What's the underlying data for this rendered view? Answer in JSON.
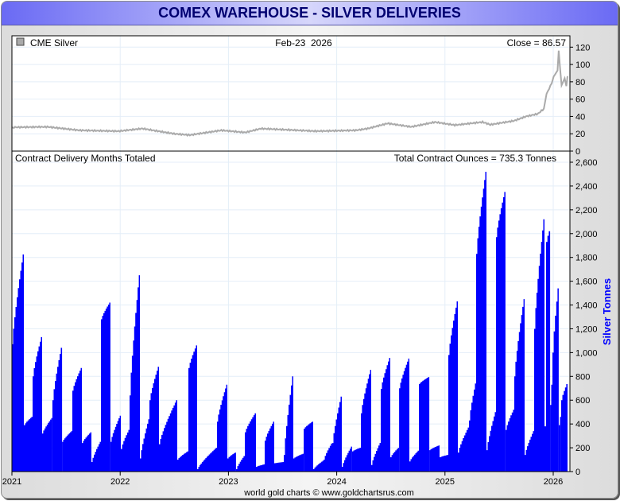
{
  "title": "COMEX WAREHOUSE - SILVER DELIVERIES",
  "footer": "world gold charts © www.goldchartsrus.com",
  "colors": {
    "bars": "#0000ff",
    "price_line": "#aaaaaa",
    "axis_title": "#0000ff",
    "title": "#000070",
    "grid": "#e4eef8"
  },
  "chart_data": [
    {
      "type": "line",
      "panel": "top",
      "legend": "CME Silver",
      "legend_icon": "gray-square-icon",
      "date_label": "Feb-23  2026",
      "close_label": "Close = 86.57",
      "ylim": [
        0,
        120
      ],
      "yticks": [
        "0",
        "20",
        "40",
        "60",
        "80",
        "100",
        "120"
      ],
      "xlim": [
        2021.0,
        2026.15
      ],
      "x": [
        2021.0,
        2021.018,
        2021.328,
        2021.62,
        2021.986,
        2022.205,
        2022.497,
        2022.643,
        2022.935,
        2023.155,
        2023.301,
        2023.812,
        2024.178,
        2024.287,
        2024.47,
        2024.689,
        2024.908,
        2025.09,
        2025.347,
        2025.419,
        2025.639,
        2025.748,
        2025.858,
        2025.913,
        2025.938,
        2025.985,
        2026.004,
        2026.04,
        2026.051,
        2026.062,
        2026.077,
        2026.106,
        2026.121,
        2026.132
      ],
      "y": [
        27,
        27.5,
        28,
        24,
        23,
        26,
        20,
        18.5,
        24,
        21.5,
        26,
        23,
        24,
        26,
        32,
        28,
        33.5,
        30,
        33.5,
        30.5,
        35,
        40,
        43,
        49,
        66,
        78,
        86,
        93,
        116,
        98,
        76,
        84,
        75,
        86.57
      ]
    },
    {
      "type": "area",
      "panel": "bottom",
      "title": "Contract Delivery Months Totaled",
      "total_label": "Total Contract Ounces = 735.3 Tonnes",
      "ylabel": "Silver Tonnes",
      "ylim": [
        0,
        2600
      ],
      "yticks": [
        "0",
        "200",
        "400",
        "600",
        "800",
        "1,000",
        "1,200",
        "1,400",
        "1,600",
        "1,800",
        "2,000",
        "2,200",
        "2,400",
        "2,600"
      ],
      "xticks": [
        "2021",
        "2022",
        "2023",
        "2024",
        "2025",
        "2026"
      ],
      "xlim": [
        2021.0,
        2026.15
      ],
      "segments_note": "each segment: [start_year, end_year, start_tonnes, end_tonnes]",
      "segments": [
        [
          2021.0,
          2021.11,
          1070,
          1825
        ],
        [
          2021.11,
          2021.191,
          390,
          460
        ],
        [
          2021.191,
          2021.279,
          800,
          1130
        ],
        [
          2021.279,
          2021.374,
          320,
          450
        ],
        [
          2021.374,
          2021.463,
          600,
          1040
        ],
        [
          2021.463,
          2021.558,
          250,
          340
        ],
        [
          2021.558,
          2021.646,
          680,
          870
        ],
        [
          2021.646,
          2021.734,
          240,
          330
        ],
        [
          2021.734,
          2021.822,
          80,
          250
        ],
        [
          2021.822,
          2021.91,
          1280,
          1420
        ],
        [
          2021.91,
          2022.006,
          250,
          470
        ],
        [
          2022.006,
          2022.087,
          190,
          350
        ],
        [
          2022.087,
          2022.182,
          640,
          1650
        ],
        [
          2022.182,
          2022.27,
          110,
          440
        ],
        [
          2022.27,
          2022.358,
          600,
          880
        ],
        [
          2022.358,
          2022.527,
          230,
          600
        ],
        [
          2022.527,
          2022.63,
          100,
          170
        ],
        [
          2022.63,
          2022.711,
          870,
          1060
        ],
        [
          2022.711,
          2022.894,
          20,
          200
        ],
        [
          2022.894,
          2022.99,
          420,
          730
        ],
        [
          2022.99,
          2023.07,
          110,
          160
        ],
        [
          2023.07,
          2023.151,
          20,
          130
        ],
        [
          2023.151,
          2023.254,
          330,
          490
        ],
        [
          2023.254,
          2023.335,
          40,
          60
        ],
        [
          2023.335,
          2023.423,
          260,
          420
        ],
        [
          2023.423,
          2023.511,
          70,
          80
        ],
        [
          2023.511,
          2023.599,
          140,
          800
        ],
        [
          2023.599,
          2023.695,
          110,
          150
        ],
        [
          2023.695,
          2023.783,
          360,
          420
        ],
        [
          2023.783,
          2023.878,
          20,
          90
        ],
        [
          2023.878,
          2023.959,
          100,
          235
        ],
        [
          2023.959,
          2024.047,
          240,
          630
        ],
        [
          2024.047,
          2024.142,
          40,
          210
        ],
        [
          2024.142,
          2024.223,
          170,
          200
        ],
        [
          2024.223,
          2024.319,
          490,
          855
        ],
        [
          2024.319,
          2024.407,
          55,
          240
        ],
        [
          2024.407,
          2024.495,
          695,
          955
        ],
        [
          2024.495,
          2024.576,
          120,
          200
        ],
        [
          2024.576,
          2024.671,
          700,
          950
        ],
        [
          2024.671,
          2024.759,
          85,
          175
        ],
        [
          2024.759,
          2024.855,
          735,
          795
        ],
        [
          2024.855,
          2024.95,
          180,
          220
        ],
        [
          2024.95,
          2025.031,
          120,
          140
        ],
        [
          2025.031,
          2025.119,
          980,
          1430
        ],
        [
          2025.119,
          2025.222,
          160,
          370
        ],
        [
          2025.222,
          2025.288,
          430,
          740
        ],
        [
          2025.288,
          2025.383,
          1830,
          2520
        ],
        [
          2025.383,
          2025.471,
          180,
          500
        ],
        [
          2025.471,
          2025.559,
          1970,
          2350
        ],
        [
          2025.559,
          2025.64,
          350,
          520
        ],
        [
          2025.64,
          2025.736,
          800,
          1450
        ],
        [
          2025.736,
          2025.824,
          140,
          340
        ],
        [
          2025.824,
          2025.919,
          1200,
          2120
        ],
        [
          2025.919,
          2025.934,
          380,
          380
        ],
        [
          2025.934,
          2025.971,
          1930,
          2020
        ],
        [
          2025.971,
          2025.993,
          560,
          730
        ],
        [
          2025.993,
          2026.051,
          1000,
          1540
        ],
        [
          2026.051,
          2026.073,
          390,
          460
        ],
        [
          2026.073,
          2026.132,
          600,
          735
        ]
      ]
    }
  ]
}
